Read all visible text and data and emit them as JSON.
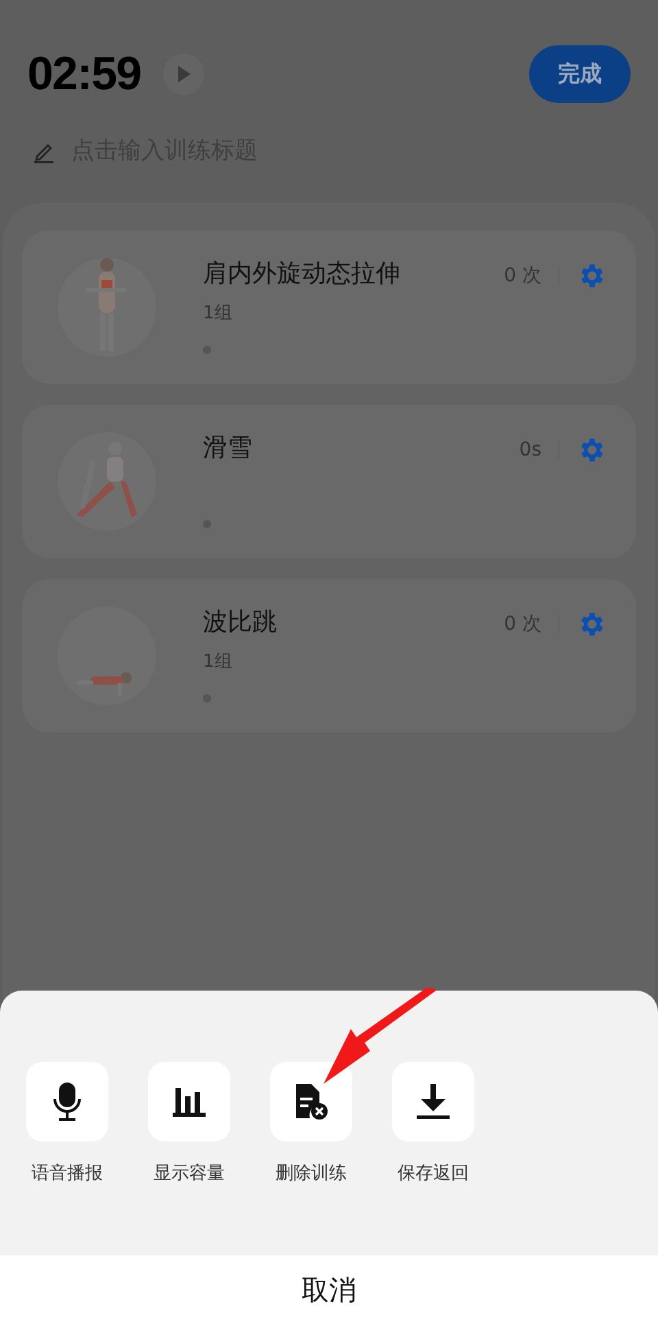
{
  "header": {
    "timer": "02:59",
    "finish_button": "完成"
  },
  "title_field": {
    "placeholder": "点击输入训练标题"
  },
  "exercises": [
    {
      "name": "肩内外旋动态拉伸",
      "count": "0 次",
      "sets": "1组"
    },
    {
      "name": "滑雪",
      "count": "0s"
    },
    {
      "name": "波比跳",
      "count": "0 次",
      "sets": "1组"
    }
  ],
  "action_sheet": {
    "actions": [
      {
        "label": "语音播报",
        "kind": "mic"
      },
      {
        "label": "显示容量",
        "kind": "bars"
      },
      {
        "label": "删除训练",
        "kind": "delete"
      },
      {
        "label": "保存返回",
        "kind": "download"
      }
    ],
    "cancel": "取消"
  }
}
